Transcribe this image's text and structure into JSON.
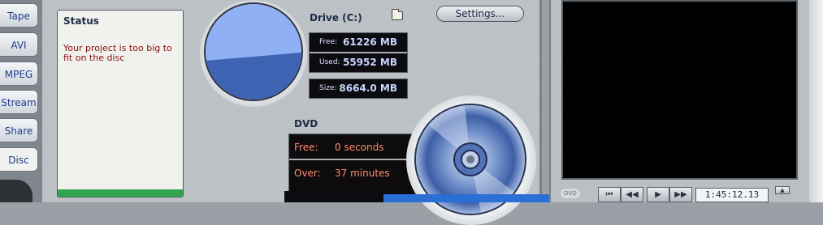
{
  "tabs": {
    "items": [
      {
        "label": "Tape"
      },
      {
        "label": "AVI"
      },
      {
        "label": "MPEG"
      },
      {
        "label": "Stream"
      },
      {
        "label": "Share"
      },
      {
        "label": "Disc"
      }
    ],
    "active": "Disc"
  },
  "status": {
    "title": "Status",
    "message": "Your project is too big to fit on the disc"
  },
  "drive": {
    "title": "Drive (C:)",
    "free_label": "Free:",
    "free_value": "61226 MB",
    "used_label": "Used:",
    "used_value": "55952 MB",
    "size_label": "Size:",
    "size_value": "8664.0 MB",
    "used_fraction": 0.477,
    "icons": {
      "folder": "folder-icon"
    }
  },
  "settings": {
    "label": "Settings..."
  },
  "dvd": {
    "title": "DVD",
    "free_label": "Free:",
    "free_value": "0 seconds",
    "over_label": "Over:",
    "over_value": "37 minutes"
  },
  "player": {
    "logo": "DVD",
    "btn_start": "⏮",
    "btn_rewind": "◀◀",
    "btn_play": "▶",
    "btn_forward": "▶▶",
    "timecode": "1:45:12.13",
    "spin_up": "▲"
  },
  "colors": {
    "accent_blue": "#1f3c8c",
    "status_error": "#8a0e0e",
    "lcd_text": "#c9d4ff",
    "dvd_text": "#ff8a6f",
    "pie_used": "#3e63b2",
    "pie_free": "#8fb0f4"
  }
}
